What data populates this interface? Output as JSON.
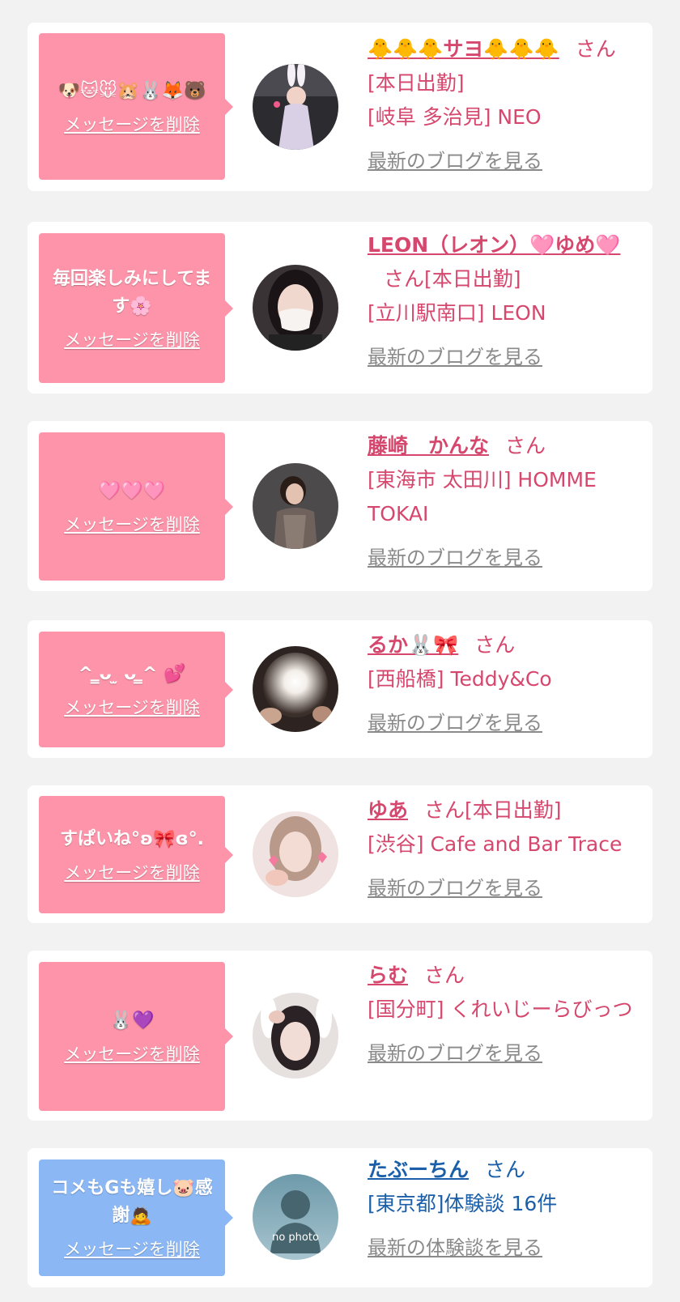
{
  "delete_label": "メッセージを削除",
  "blog_label": "最新のブログを見る",
  "review_label": "最新の体験談を見る",
  "san": "さん",
  "colors": {
    "pink_bubble": "#fe94a9",
    "blue_bubble": "#8bb8f5",
    "pink_text": "#d6476d",
    "blue_text": "#1b5fa8",
    "link_gray": "#8a8a8a",
    "background": "#f2f2f2"
  },
  "cards": [
    {
      "message": "🐶🐱🐭🐹🐰🦊🐻",
      "name": "🐥🐥🐥サヨ🐥🐥🐥",
      "status": "[本日出勤]",
      "shop": "[岐阜 多治見] NEO",
      "avatar_icon": "bunny-girl-photo"
    },
    {
      "message": "毎回楽しみにしてます🌸",
      "name": "LEON（レオン）🩷ゆめ🩷",
      "status": "[本日出勤]",
      "shop": "[立川駅南口] LEON",
      "avatar_icon": "masked-girl-photo"
    },
    {
      "message": "🩷🩷🩷",
      "name": "藤崎　かんな",
      "status": "",
      "shop": "[東海市 太田川] HOMME TOKAI",
      "avatar_icon": "woman-photo"
    },
    {
      "message": "^ ̳ᴗ ̫ ᴗ ̳^ 💕",
      "name": "るか🐰🎀",
      "status": "",
      "shop": "[西船橋] Teddy&Co",
      "avatar_icon": "blurred-face-photo"
    },
    {
      "message": "すぱいね°ʚ🎀ɞ°.",
      "name": "ゆあ",
      "status": "[本日出勤]",
      "shop": "[渋谷] Cafe and Bar Trace",
      "avatar_icon": "girl-hearts-photo"
    },
    {
      "message": "🐰💜",
      "name": "らむ",
      "status": "",
      "shop": "[国分町] くれいじーらびっつ",
      "avatar_icon": "bunny-ears-girl-photo"
    },
    {
      "message": "コメもGも嬉し🐷感謝🙇",
      "name": "たぶーちん",
      "status": "",
      "shop": "[東京都]体験談 16件",
      "avatar_icon": "no-photo-silhouette",
      "avatar_text": "no photo"
    }
  ]
}
